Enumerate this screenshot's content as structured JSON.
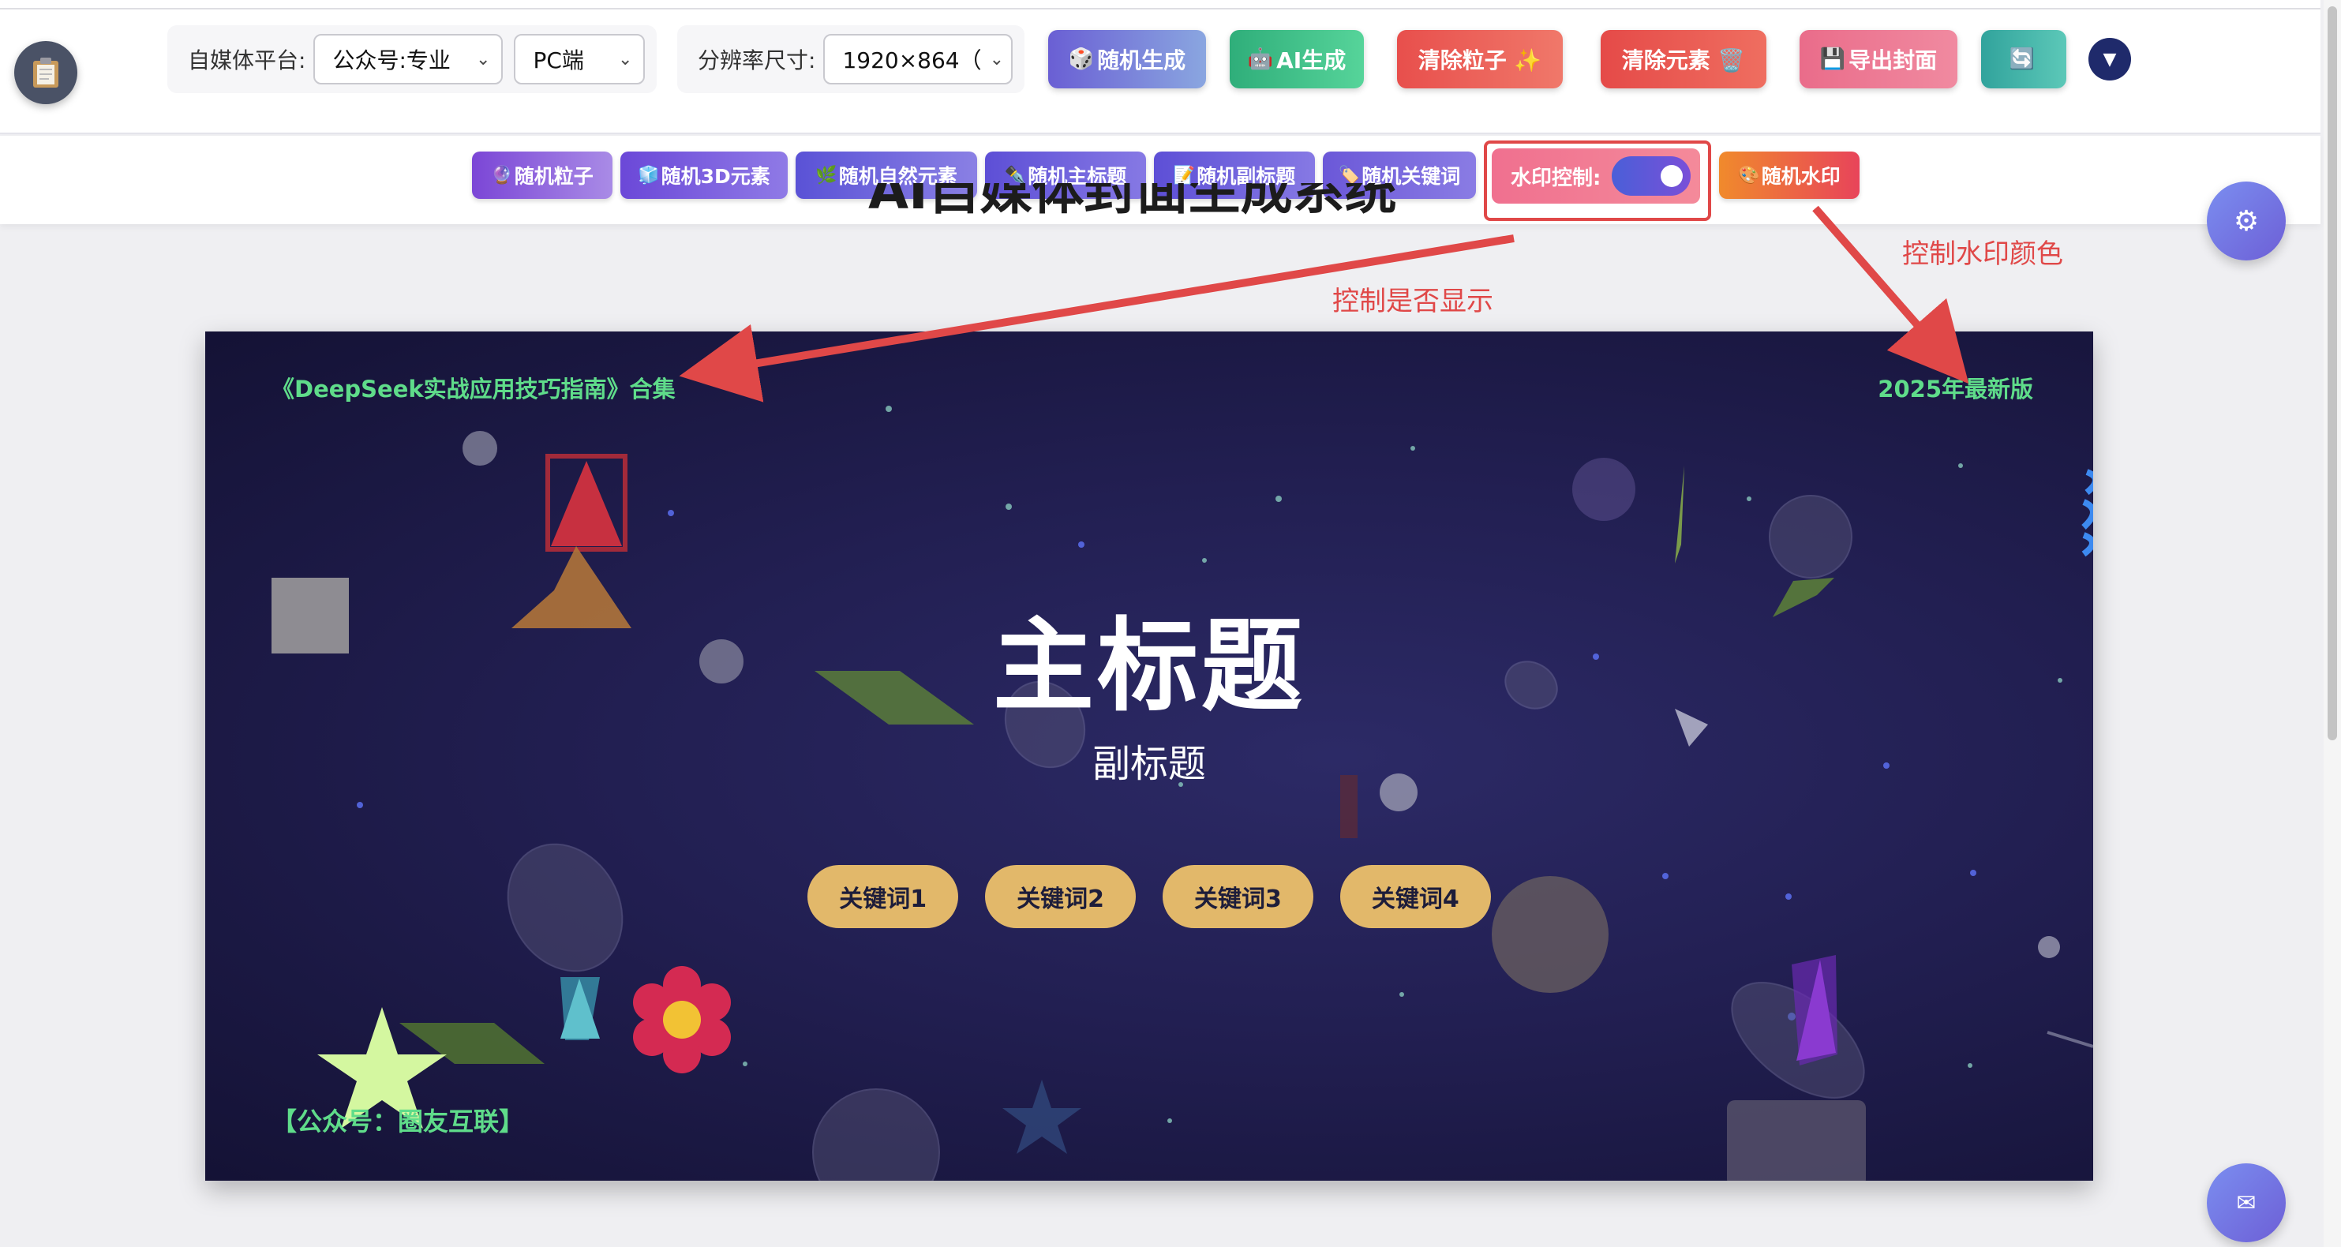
{
  "toolbar": {
    "platform_label": "自媒体平台:",
    "platform_value": "公众号:专业",
    "device_value": "PC端",
    "resolution_label": "分辨率尺寸:",
    "resolution_value": "1920×864（",
    "buttons": [
      {
        "icon": "🎲",
        "label": "随机生成",
        "color": "#6c7fd8"
      },
      {
        "icon": "🤖",
        "label": "AI生成",
        "color": "#3fb67e"
      },
      {
        "icon": "",
        "label": "清除粒子 ✨",
        "color": "#e85a55"
      },
      {
        "icon": "",
        "label": "清除元素 🗑️",
        "color": "#e6574f"
      },
      {
        "icon": "💾",
        "label": "导出封面",
        "color": "#ef6f8e"
      },
      {
        "icon": "🔄",
        "label": "",
        "color": "#3aa9a0"
      }
    ]
  },
  "row2": {
    "buttons": [
      {
        "icon": "🔮",
        "label": "随机粒子"
      },
      {
        "icon": "🧊",
        "label": "随机3D元素"
      },
      {
        "icon": "🌿",
        "label": "随机自然元素"
      },
      {
        "icon": "✒️",
        "label": "随机主标题"
      },
      {
        "icon": "📝",
        "label": "随机副标题"
      },
      {
        "icon": "🏷️",
        "label": "随机关键词"
      }
    ],
    "watermark_control_label": "水印控制:",
    "watermark_enabled": true,
    "random_watermark": {
      "icon": "🎨",
      "label": "随机水印"
    }
  },
  "page_title": "AI自媒体封面生成系统",
  "cover": {
    "watermark_top_left": "《DeepSeek实战应用技巧指南》合集",
    "watermark_top_right": "2025年最新版",
    "watermark_bottom_left": "【公众号：圈友互联】",
    "watermark_color": "#5fdc8a",
    "main_title": "主标题",
    "sub_title": "副标题",
    "keywords": [
      "关键词1",
      "关键词2",
      "关键词3",
      "关键词4"
    ],
    "keyword_color": "#e2b86a"
  },
  "annotations": {
    "show_control": "控制是否显示",
    "color_control": "控制水印颜色"
  },
  "icons": {
    "clipboard": "clipboard-icon",
    "dropdown": "triangle-down-icon",
    "settings": "gear-icon",
    "mail": "mail-icon"
  }
}
